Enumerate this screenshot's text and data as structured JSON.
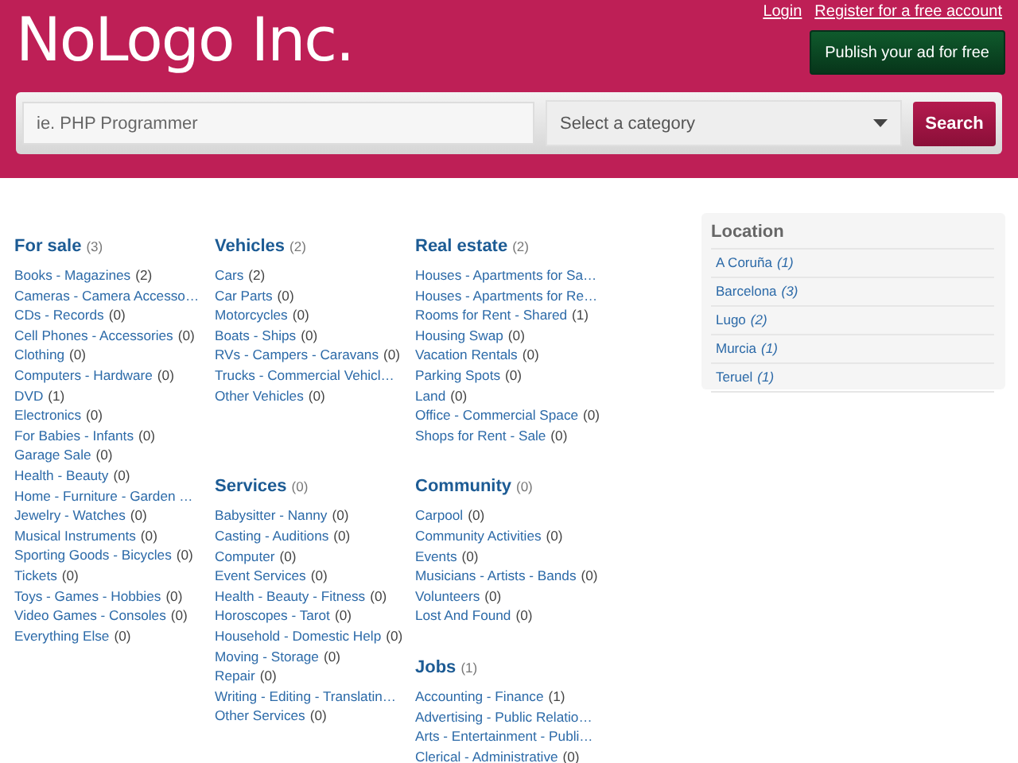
{
  "header": {
    "logo": "NoLogo Inc.",
    "links": [
      "Login",
      "Register for a free account"
    ],
    "publish_button": "Publish your ad for free"
  },
  "search": {
    "placeholder": "ie. PHP Programmer",
    "category_placeholder": "Select a category",
    "button": "Search"
  },
  "columns": [
    [
      {
        "title": "For sale",
        "count": "(3)",
        "items": [
          {
            "name": "Books - Magazines",
            "count": "(2)"
          },
          {
            "name": "Cameras - Camera Accesso…"
          },
          {
            "name": "CDs - Records",
            "count": "(0)"
          },
          {
            "name": "Cell Phones - Accessories",
            "count": "(0)"
          },
          {
            "name": "Clothing",
            "count": "(0)"
          },
          {
            "name": "Computers - Hardware",
            "count": "(0)"
          },
          {
            "name": "DVD",
            "count": "(1)"
          },
          {
            "name": "Electronics",
            "count": "(0)"
          },
          {
            "name": "For Babies - Infants",
            "count": "(0)"
          },
          {
            "name": "Garage Sale",
            "count": "(0)"
          },
          {
            "name": "Health - Beauty",
            "count": "(0)"
          },
          {
            "name": "Home - Furniture - Garden …"
          },
          {
            "name": "Jewelry - Watches",
            "count": "(0)"
          },
          {
            "name": "Musical Instruments",
            "count": "(0)"
          },
          {
            "name": "Sporting Goods - Bicycles",
            "count": "(0)"
          },
          {
            "name": "Tickets",
            "count": "(0)"
          },
          {
            "name": "Toys - Games - Hobbies",
            "count": "(0)"
          },
          {
            "name": "Video Games - Consoles",
            "count": "(0)"
          },
          {
            "name": "Everything Else",
            "count": "(0)"
          }
        ]
      }
    ],
    [
      {
        "title": "Vehicles",
        "count": "(2)",
        "items": [
          {
            "name": "Cars",
            "count": "(2)"
          },
          {
            "name": "Car Parts",
            "count": "(0)"
          },
          {
            "name": "Motorcycles",
            "count": "(0)"
          },
          {
            "name": "Boats - Ships",
            "count": "(0)"
          },
          {
            "name": "RVs - Campers - Caravans",
            "count": "(0)"
          },
          {
            "name": "Trucks - Commercial Vehicl…"
          },
          {
            "name": "Other Vehicles",
            "count": "(0)"
          }
        ]
      },
      {
        "title": "Services",
        "count": "(0)",
        "items": [
          {
            "name": "Babysitter - Nanny",
            "count": "(0)"
          },
          {
            "name": "Casting - Auditions",
            "count": "(0)"
          },
          {
            "name": "Computer",
            "count": "(0)"
          },
          {
            "name": "Event Services",
            "count": "(0)"
          },
          {
            "name": "Health - Beauty - Fitness",
            "count": "(0)"
          },
          {
            "name": "Horoscopes - Tarot",
            "count": "(0)"
          },
          {
            "name": "Household - Domestic Help",
            "count": "(0)"
          },
          {
            "name": "Moving - Storage",
            "count": "(0)"
          },
          {
            "name": "Repair",
            "count": "(0)"
          },
          {
            "name": "Writing - Editing - Translatin…"
          },
          {
            "name": "Other Services",
            "count": "(0)"
          }
        ]
      }
    ],
    [
      {
        "title": "Real estate",
        "count": "(2)",
        "items": [
          {
            "name": "Houses - Apartments for Sa…"
          },
          {
            "name": "Houses - Apartments for Re…"
          },
          {
            "name": "Rooms for Rent - Shared",
            "count": "(1)"
          },
          {
            "name": "Housing Swap",
            "count": "(0)"
          },
          {
            "name": "Vacation Rentals",
            "count": "(0)"
          },
          {
            "name": "Parking Spots",
            "count": "(0)"
          },
          {
            "name": "Land",
            "count": "(0)"
          },
          {
            "name": "Office - Commercial Space",
            "count": "(0)"
          },
          {
            "name": "Shops for Rent - Sale",
            "count": "(0)"
          }
        ]
      },
      {
        "title": "Community",
        "count": "(0)",
        "items": [
          {
            "name": "Carpool",
            "count": "(0)"
          },
          {
            "name": "Community Activities",
            "count": "(0)"
          },
          {
            "name": "Events",
            "count": "(0)"
          },
          {
            "name": "Musicians - Artists - Bands",
            "count": "(0)"
          },
          {
            "name": "Volunteers",
            "count": "(0)"
          },
          {
            "name": "Lost And Found",
            "count": "(0)"
          }
        ]
      },
      {
        "title": "Jobs",
        "count": "(1)",
        "items": [
          {
            "name": "Accounting - Finance",
            "count": "(1)"
          },
          {
            "name": "Advertising - Public Relatio…"
          },
          {
            "name": "Arts - Entertainment - Publi…"
          },
          {
            "name": "Clerical - Administrative",
            "count": "(0)"
          }
        ]
      }
    ]
  ],
  "location": {
    "title": "Location",
    "items": [
      {
        "name": "A Coruña",
        "count": "(1)"
      },
      {
        "name": "Barcelona",
        "count": "(3)"
      },
      {
        "name": "Lugo",
        "count": "(2)"
      },
      {
        "name": "Murcia",
        "count": "(1)"
      },
      {
        "name": "Teruel",
        "count": "(1)"
      }
    ]
  }
}
